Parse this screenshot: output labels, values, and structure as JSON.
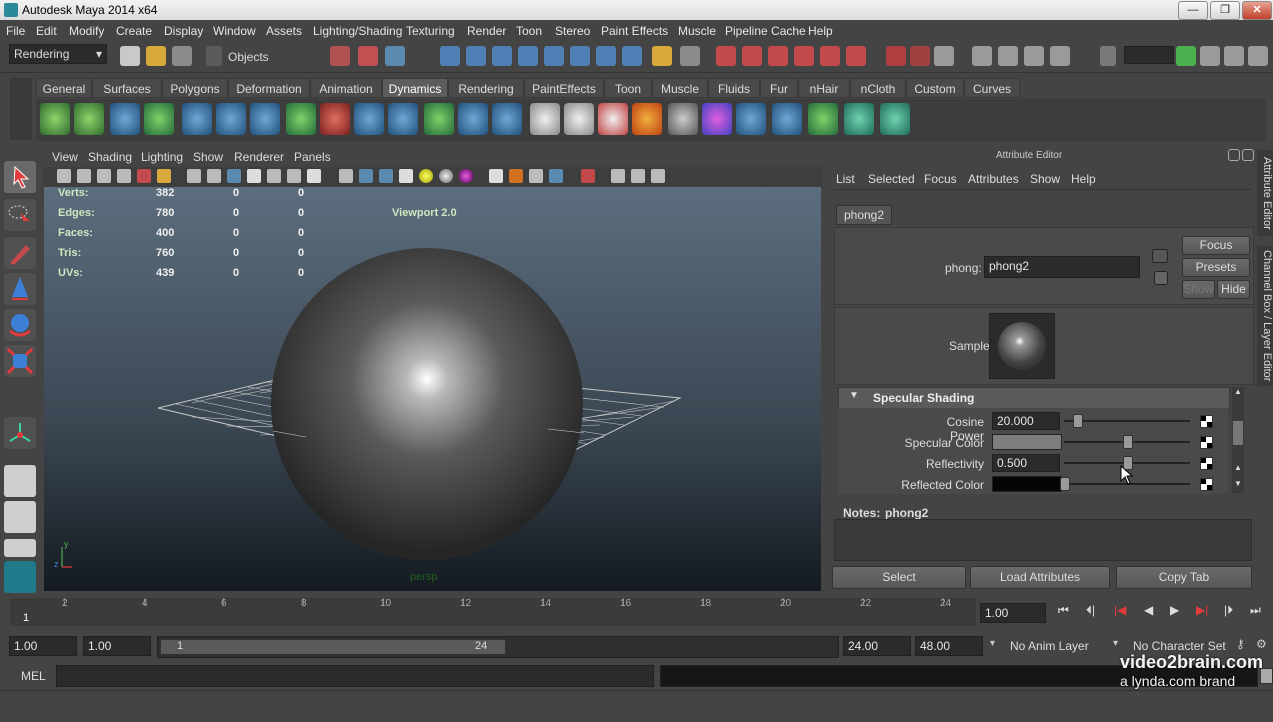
{
  "window": {
    "title": "Autodesk Maya 2014 x64"
  },
  "menubar": [
    "File",
    "Edit",
    "Modify",
    "Create",
    "Display",
    "Window",
    "Assets",
    "Lighting/Shading",
    "Texturing",
    "Render",
    "Toon",
    "Stereo",
    "Paint Effects",
    "Muscle",
    "Pipeline Cache",
    "Help"
  ],
  "statusline": {
    "menuset": "Rendering",
    "selection_mode": "Objects"
  },
  "shelf": {
    "tabs": [
      "General",
      "Surfaces",
      "Polygons",
      "Deformation",
      "Animation",
      "Dynamics",
      "Rendering",
      "PaintEffects",
      "Toon",
      "Muscle",
      "Fluids",
      "Fur",
      "nHair",
      "nCloth",
      "Custom",
      "Curves"
    ],
    "active_tab": "Dynamics"
  },
  "viewport": {
    "menu": [
      "View",
      "Shading",
      "Lighting",
      "Show",
      "Renderer",
      "Panels"
    ],
    "hud": {
      "rows": [
        {
          "label": "Verts:",
          "v1": "382",
          "v2": "0",
          "v3": "0"
        },
        {
          "label": "Edges:",
          "v1": "780",
          "v2": "0",
          "v3": "0"
        },
        {
          "label": "Faces:",
          "v1": "400",
          "v2": "0",
          "v3": "0"
        },
        {
          "label": "Tris:",
          "v1": "760",
          "v2": "0",
          "v3": "0"
        },
        {
          "label": "UVs:",
          "v1": "439",
          "v2": "0",
          "v3": "0"
        }
      ],
      "renderer": "Viewport 2.0",
      "camera": "persp"
    }
  },
  "attribute_editor": {
    "title": "Attribute Editor",
    "menu": [
      "List",
      "Selected",
      "Focus",
      "Attributes",
      "Show",
      "Help"
    ],
    "tab": "phong2",
    "node_label": "phong:",
    "node_value": "phong2",
    "buttons": {
      "focus": "Focus",
      "presets": "Presets",
      "show": "Show",
      "hide": "Hide"
    },
    "sample_label": "Sample",
    "section": "Specular Shading",
    "attributes": [
      {
        "label": "Cosine Power",
        "value": "20.000",
        "slider": 0.1
      },
      {
        "label": "Specular Color",
        "value": "",
        "slider": 0.5
      },
      {
        "label": "Reflectivity",
        "value": "0.500",
        "slider": 0.5
      },
      {
        "label": "Reflected Color",
        "value": "",
        "slider": 0.0
      }
    ],
    "notes_label": "Notes:",
    "notes_node": "phong2",
    "bottom_buttons": [
      "Select",
      "Load Attributes",
      "Copy Tab"
    ],
    "side_tabs": [
      "Attribute Editor",
      "Channel Box / Layer Editor"
    ]
  },
  "timeslider": {
    "ticks": [
      "2",
      "4",
      "6",
      "8",
      "10",
      "12",
      "14",
      "16",
      "18",
      "20",
      "22",
      "24"
    ],
    "current_frame_label": "1",
    "current_time": "1.00"
  },
  "rangeslider": {
    "start": "1.00",
    "start_inner": "1.00",
    "range_start": "1",
    "range_end": "24",
    "end": "24.00",
    "end_outer": "48.00",
    "anim_layer": "No Anim Layer",
    "character_set": "No Character Set"
  },
  "commandline": {
    "label": "MEL"
  },
  "watermark": {
    "line1": "video2brain.com",
    "line2": "a lynda.com brand"
  },
  "colors": {
    "accent": "#2a8a9a",
    "panel": "#444444",
    "field": "#2b2b2b"
  }
}
